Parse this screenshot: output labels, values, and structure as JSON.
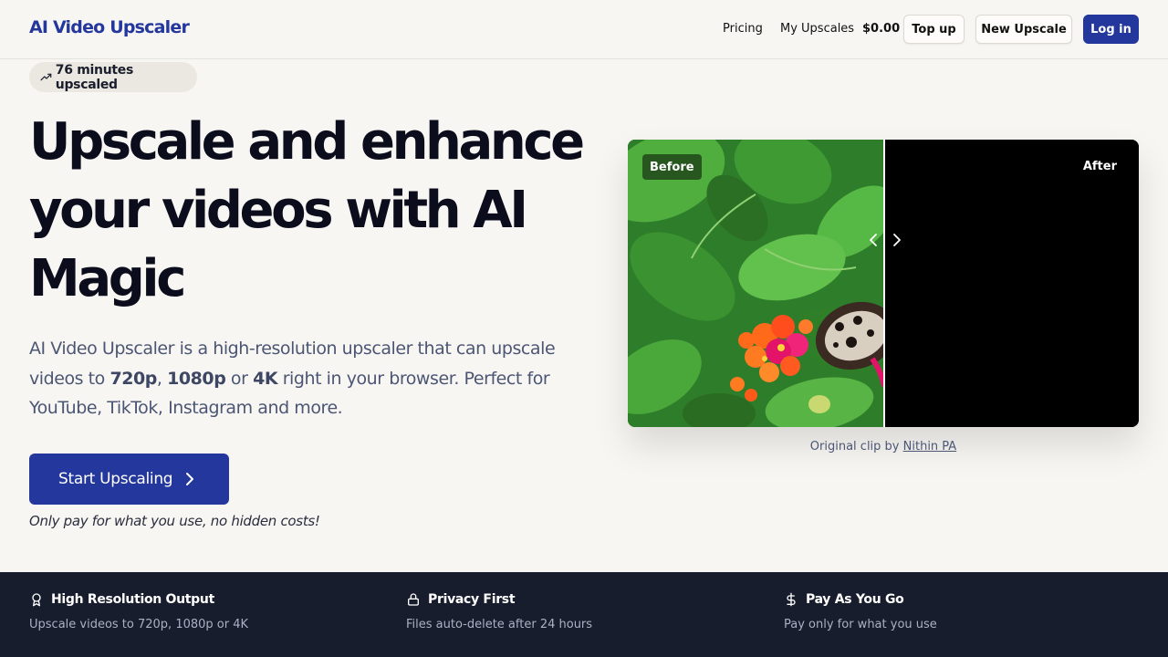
{
  "header": {
    "logo": "AI Video Upscaler",
    "nav": {
      "pricing": "Pricing",
      "my_upscales": "My Upscales"
    },
    "balance": "$0.00",
    "top_up": "Top up",
    "new_upscale": "New Upscale",
    "login": "Log in"
  },
  "badge": {
    "icon": "trending-up-icon",
    "text": "76 minutes upscaled"
  },
  "hero": {
    "headline": [
      "Upscale and enhance",
      "your videos with AI",
      "Magic"
    ],
    "desc_part1": "AI Video Upscaler is a high-resolution upscaler that can upscale videos to ",
    "res1": "720p",
    "sep1": ", ",
    "res2": "1080p",
    "sep2": " or ",
    "res3": "4K",
    "desc_part2": " right in your browser. Perfect for YouTube, TikTok, Instagram and more.",
    "cta": "Start Upscaling",
    "note": "Only pay for what you use, no hidden costs!"
  },
  "compare": {
    "before_label": "Before",
    "after_label": "After",
    "credit_prefix": "Original clip by ",
    "credit_author": "Nithin PA"
  },
  "features": [
    {
      "icon": "award-icon",
      "title": "High Resolution Output",
      "desc": "Upscale videos to 720p, 1080p or 4K"
    },
    {
      "icon": "lock-icon",
      "title": "Privacy First",
      "desc": "Files auto-delete after 24 hours"
    },
    {
      "icon": "dollar-icon",
      "title": "Pay As You Go",
      "desc": "Pay only for what you use"
    }
  ],
  "colors": {
    "brand": "#24379c",
    "background": "#f8f6f2",
    "footer": "#181d2d"
  }
}
